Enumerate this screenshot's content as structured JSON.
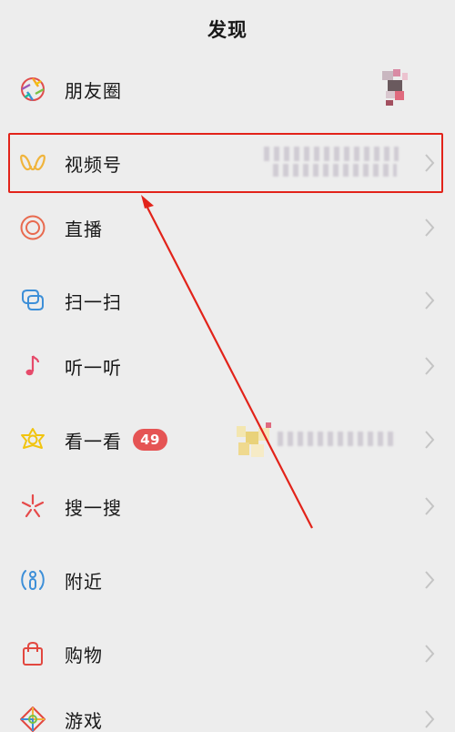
{
  "header": {
    "title": "发现"
  },
  "menu": [
    {
      "key": "moments",
      "label": "朋友圈",
      "icon": "moments-aperture-icon"
    },
    {
      "key": "channels",
      "label": "视频号",
      "icon": "channels-butterfly-icon"
    },
    {
      "key": "live",
      "label": "直播",
      "icon": "live-target-icon"
    },
    {
      "key": "scan",
      "label": "扫一扫",
      "icon": "scan-icon"
    },
    {
      "key": "listen",
      "label": "听一听",
      "icon": "music-note-icon"
    },
    {
      "key": "top_stories",
      "label": "看一看",
      "icon": "top-stories-star-icon",
      "badge": "49"
    },
    {
      "key": "search",
      "label": "搜一搜",
      "icon": "search-sparkle-icon"
    },
    {
      "key": "nearby",
      "label": "附近",
      "icon": "nearby-person-icon"
    },
    {
      "key": "shopping",
      "label": "购物",
      "icon": "shopping-bag-icon"
    },
    {
      "key": "games",
      "label": "游戏",
      "icon": "games-diamond-icon"
    }
  ],
  "colors": {
    "background": "#ededed",
    "highlight": "#e2231a",
    "badge": "#e55454",
    "channels": "#f0b43c",
    "live": "#e86a4f",
    "scan": "#3d8fd8",
    "music": "#e64a6a",
    "nearby": "#3d8fd8",
    "shopping": "#e2473f"
  }
}
